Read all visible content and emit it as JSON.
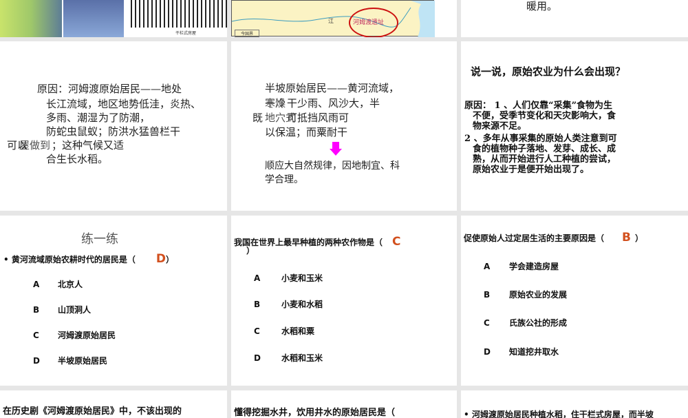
{
  "slides": {
    "s1": {
      "caption": "干栏式房屋"
    },
    "s2": {
      "site_label": "河姆渡遗址",
      "legend": "今国界",
      "river_char": "江"
    },
    "s3": {
      "text": "暖用。"
    },
    "s4": {
      "lines": [
        "原因：河姆渡原始居民——地处",
        "长江流域，地区地势低洼，炎热、",
        "多雨、潮湿",
        "为了防潮，",
        "防蛇虫鼠蚁；防洪水猛兽栏干",
        "可以",
        "屋做到",
        "；这种气候又适",
        "合生长水稻。"
      ]
    },
    "s5": {
      "lines": [
        "半坡原始居民——黄河流域，",
        "寒冷",
        "干燥",
        "干少雨、风沙大，半",
        "既",
        "地穴式",
        "可抵挡风雨可",
        "以保温；而粟耐干"
      ],
      "conclusion": [
        "顺应大自然规律，因地制宜、科",
        "学合理。"
      ]
    },
    "s6": {
      "title": "说一说，原始农业为什么会出现？",
      "lines": [
        "原因： 1 、人们仅靠“采集”食物为生",
        "不便，受季节变化和天灾影响大，食",
        "物来源不足。",
        "2 、多年从事采集的原始人类注意到可",
        "食的植物种子落地、发芽、成长、成",
        "熟，从而开始进行人工种植的尝试，",
        "原始农业于是便开始出现了。"
      ]
    },
    "s7": {
      "title": "练一练",
      "question": "黄河流域原始农耕时代的居民是（",
      "answer": "D",
      "close": "）",
      "options": [
        {
          "letter": "A",
          "text": "北京人"
        },
        {
          "letter": "B",
          "text": "山顶洞人"
        },
        {
          "letter": "C",
          "text": "河姆渡原始居民"
        },
        {
          "letter": "D",
          "text": "半坡原始居民"
        }
      ]
    },
    "s8": {
      "question": "我国在世界上最早种植的两种农作物是（",
      "answer": "C",
      "close": "）",
      "options": [
        {
          "letter": "A",
          "text": "小麦和玉米"
        },
        {
          "letter": "B",
          "text": "小麦和水稻"
        },
        {
          "letter": "C",
          "text": "水稻和粟"
        },
        {
          "letter": "D",
          "text": "水稻和玉米"
        }
      ]
    },
    "s9": {
      "question": "促使原始人过定居生活的主要原因是（",
      "answer": "B",
      "close": "）",
      "options": [
        {
          "letter": "A",
          "text": "学会建造房屋"
        },
        {
          "letter": "B",
          "text": "原始农业的发展"
        },
        {
          "letter": "C",
          "text": "氏族公社的形成"
        },
        {
          "letter": "D",
          "text": "知道挖井取水"
        }
      ]
    },
    "s10": {
      "text": "在历史剧《河姆渡原始居民》中，不该出现的"
    },
    "s11": {
      "text": "懂得挖掘水井，饮用井水的原始居民是（"
    },
    "s12": {
      "text": "• 河姆渡原始居民种植水稻，住干栏式房屋，而半坡"
    }
  },
  "colors": {
    "answer": "#d2501e",
    "arrow": "#ff00ff",
    "map_circle": "#cc1111"
  }
}
